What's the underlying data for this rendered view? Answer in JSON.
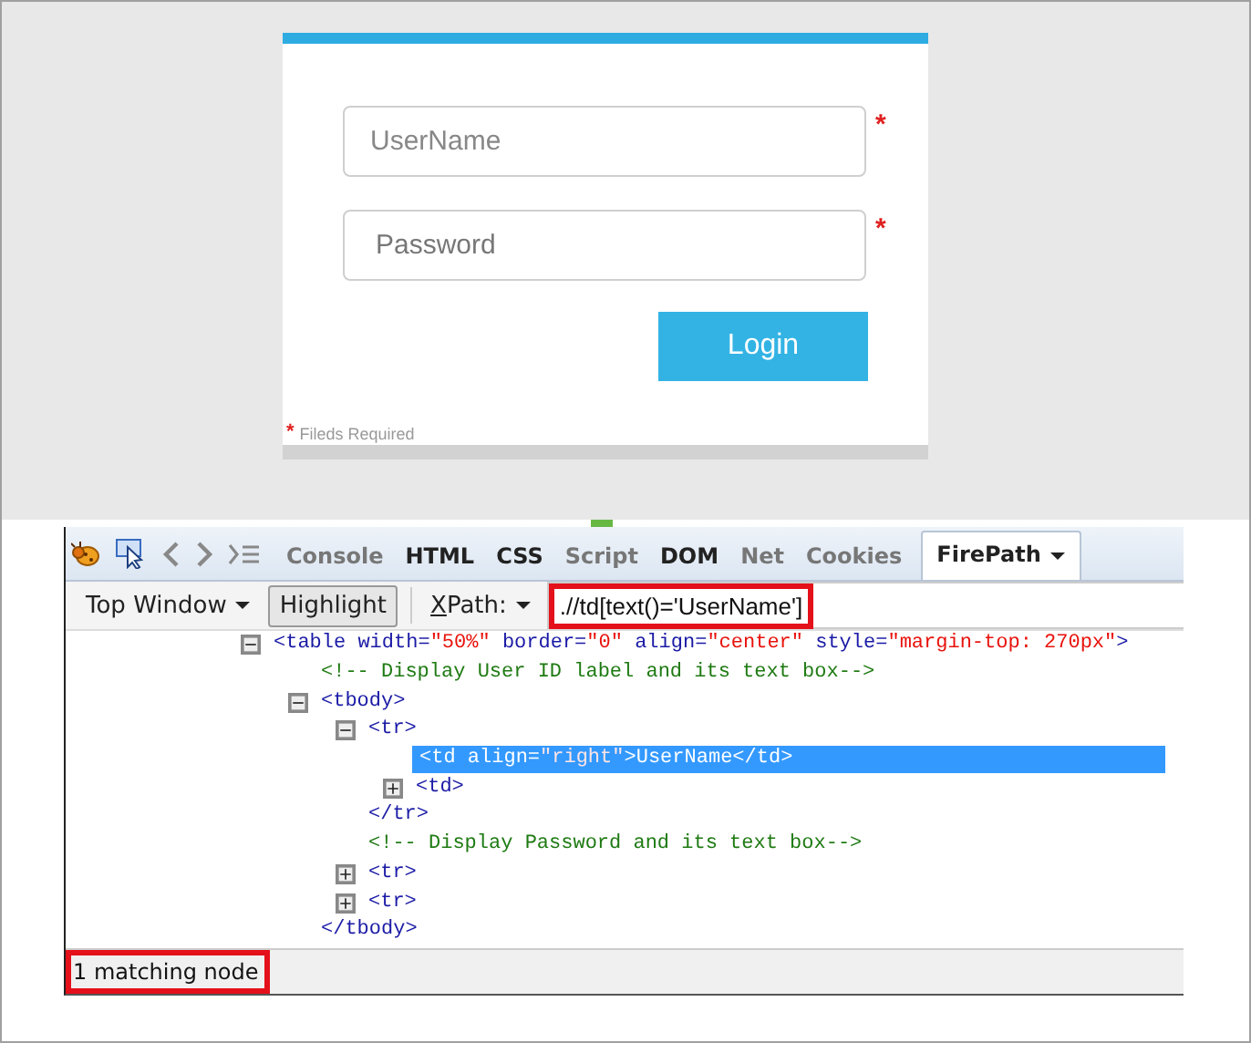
{
  "login_form": {
    "fields": [
      {
        "placeholder": "UserName",
        "required_mark": "*"
      },
      {
        "placeholder": "Password",
        "required_mark": "*"
      }
    ],
    "button": "Login",
    "footnote": {
      "mark": "*",
      "text": "Fileds Required"
    }
  },
  "devtools": {
    "tabs": [
      {
        "label": "Console",
        "selected": false,
        "disabled": true
      },
      {
        "label": "HTML",
        "selected": false,
        "disabled": false
      },
      {
        "label": "CSS",
        "selected": false,
        "disabled": false
      },
      {
        "label": "Script",
        "selected": false,
        "disabled": true
      },
      {
        "label": "DOM",
        "selected": false,
        "disabled": false
      },
      {
        "label": "Net",
        "selected": false,
        "disabled": true
      },
      {
        "label": "Cookies",
        "selected": false,
        "disabled": true
      },
      {
        "label": "FirePath",
        "selected": true,
        "disabled": false
      }
    ],
    "frame_selector": "Top Window",
    "highlight_button": {
      "label": "Highlight",
      "pressed": true
    },
    "xpath_label": "XPath:",
    "xpath": {
      "value": ".//td[text()='UserName']",
      "annotated": true
    },
    "tree": [
      {
        "kind": "element",
        "expanded": true,
        "selected": false,
        "segments": [
          {
            "kind": "tag",
            "text": "<table"
          },
          {
            "kind": "attr",
            "text": " width="
          },
          {
            "kind": "value",
            "text": "\"50%\""
          },
          {
            "kind": "attr",
            "text": " border="
          },
          {
            "kind": "value",
            "text": "\"0\""
          },
          {
            "kind": "attr",
            "text": " align="
          },
          {
            "kind": "value",
            "text": "\"center\""
          },
          {
            "kind": "attr",
            "text": " style="
          },
          {
            "kind": "value",
            "text": "\"margin-top: 270px\""
          },
          {
            "kind": "tag",
            "text": ">"
          }
        ],
        "children": [
          {
            "kind": "comment",
            "selected": false,
            "segments": [
              {
                "kind": "comment",
                "text": "<!-- Display User ID label and its text box-->"
              }
            ]
          },
          {
            "kind": "element",
            "expanded": true,
            "selected": false,
            "segments": [
              {
                "kind": "tag",
                "text": "<tbody>"
              }
            ],
            "children": [
              {
                "kind": "element",
                "expanded": true,
                "selected": false,
                "segments": [
                  {
                    "kind": "tag",
                    "text": "<tr>"
                  }
                ],
                "children": [
                  {
                    "kind": "leaf",
                    "selected": true,
                    "segments": [
                      {
                        "kind": "tag",
                        "text": "<td"
                      },
                      {
                        "kind": "attr",
                        "text": " align="
                      },
                      {
                        "kind": "value",
                        "text": "\"right\""
                      },
                      {
                        "kind": "tag",
                        "text": ">"
                      },
                      {
                        "kind": "text",
                        "text": "UserName"
                      },
                      {
                        "kind": "tag",
                        "text": "</td>"
                      }
                    ]
                  },
                  {
                    "kind": "element",
                    "expanded": false,
                    "selected": false,
                    "segments": [
                      {
                        "kind": "tag",
                        "text": "<td>"
                      }
                    ]
                  },
                  {
                    "kind": "closing",
                    "selected": false,
                    "segments": [
                      {
                        "kind": "tag",
                        "text": "</tr>"
                      }
                    ]
                  }
                ]
              },
              {
                "kind": "comment",
                "selected": false,
                "segments": [
                  {
                    "kind": "comment",
                    "text": "<!-- Display Password and its text box-->"
                  }
                ]
              },
              {
                "kind": "element",
                "expanded": false,
                "selected": false,
                "segments": [
                  {
                    "kind": "tag",
                    "text": "<tr>"
                  }
                ]
              },
              {
                "kind": "element",
                "expanded": false,
                "selected": false,
                "segments": [
                  {
                    "kind": "tag",
                    "text": "<tr>"
                  }
                ]
              },
              {
                "kind": "closing",
                "selected": false,
                "segments": [
                  {
                    "kind": "tag",
                    "text": "</tbody>"
                  }
                ]
              }
            ]
          }
        ]
      }
    ],
    "status": {
      "text": "1 matching node",
      "annotated": true
    }
  }
}
